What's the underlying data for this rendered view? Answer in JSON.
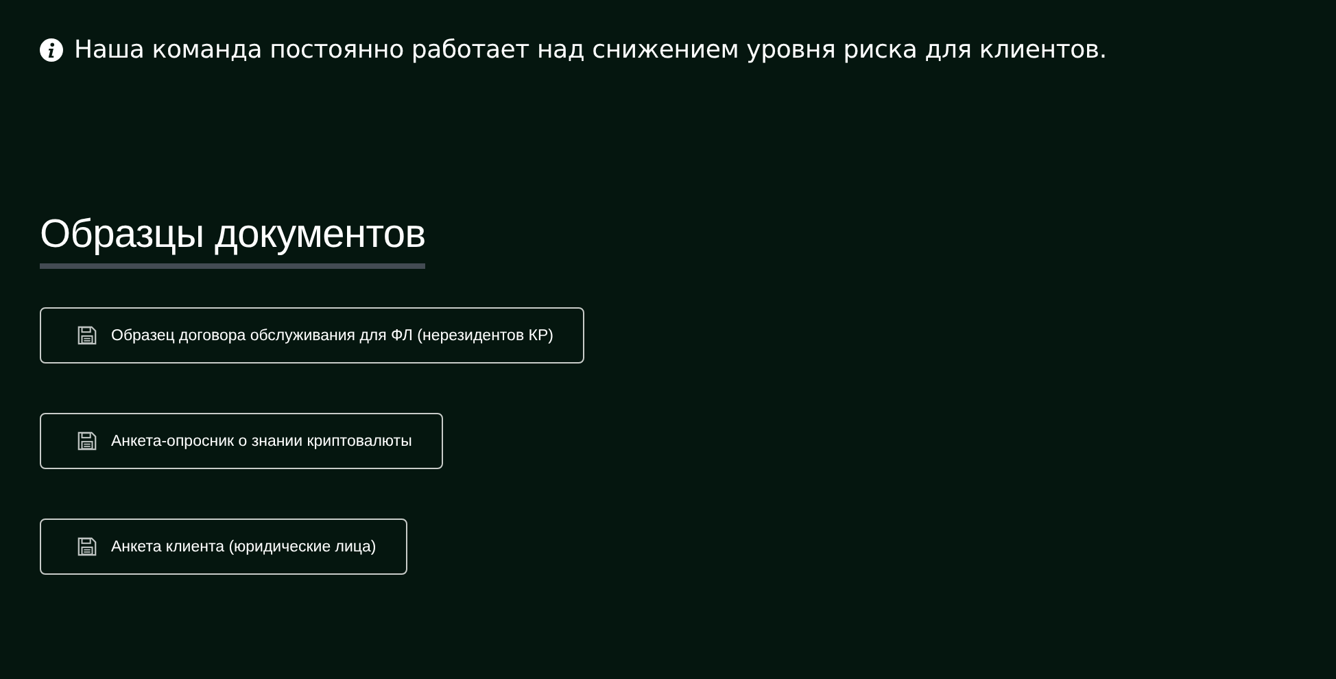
{
  "notice": {
    "text": "Наша команда постоянно работает над снижением уровня риска для клиентов."
  },
  "section": {
    "title": "Образцы документов"
  },
  "documents": [
    {
      "label": "Образец договора обслуживания для ФЛ (нерезидентов КР)"
    },
    {
      "label": "Анкета-опросник о знании криптовалюты"
    },
    {
      "label": "Анкета клиента (юридические лица)"
    }
  ]
}
